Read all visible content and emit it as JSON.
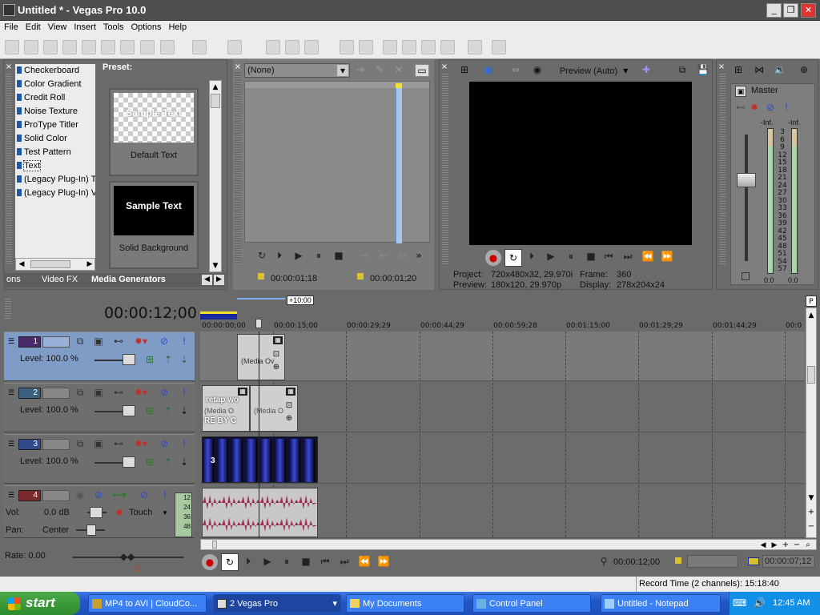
{
  "window": {
    "title": "Untitled * - Vegas Pro 10.0"
  },
  "menu": [
    "File",
    "Edit",
    "View",
    "Insert",
    "Tools",
    "Options",
    "Help"
  ],
  "generators": {
    "items": [
      "Checkerboard",
      "Color Gradient",
      "Credit Roll",
      "Noise Texture",
      "ProType Titler",
      "Solid Color",
      "Test Pattern",
      "Text",
      "(Legacy Plug-In) T",
      "(Legacy Plug-In) V"
    ],
    "selected": "Text",
    "preset_label": "Preset:",
    "presets": [
      {
        "sample": "Sample Text",
        "caption": "Default Text"
      },
      {
        "sample": "Sample Text",
        "caption": "Solid Background"
      }
    ],
    "tabs": [
      "ons",
      "Video FX",
      "Media Generators"
    ]
  },
  "trimmer": {
    "dropdown": "(None)",
    "time_in": "00:00:01;18",
    "time_out": "00:00:01;20"
  },
  "preview": {
    "mode": "Preview (Auto)",
    "project_label": "Project:",
    "project_value": "720x480x32, 29.970i",
    "frame_label": "Frame:",
    "frame_value": "360",
    "preview_label": "Preview:",
    "preview_value": "180x120, 29.970p",
    "display_label": "Display:",
    "display_value": "278x204x24"
  },
  "mixer": {
    "title": "Master",
    "inf_left": "-Inf.",
    "inf_right": "-Inf.",
    "scale": [
      "3",
      "6",
      "9",
      "12",
      "15",
      "18",
      "21",
      "24",
      "27",
      "30",
      "33",
      "36",
      "39",
      "42",
      "45",
      "48",
      "51",
      "54",
      "57"
    ],
    "bottom_left": "0.0",
    "bottom_right": "0.0"
  },
  "timeline": {
    "timecode": "00:00:12;00",
    "zoom_label": "+10:00",
    "ruler": [
      "00:00:00;00",
      "00:00:15;00",
      "00:00:29;29",
      "00:00:44;29",
      "00:00:59;28",
      "00:01:15;00",
      "00:01:29;29",
      "00:01:44;29",
      "00:0"
    ],
    "tracks": [
      {
        "num": "1",
        "level": "Level: 100.0 %",
        "color": "#4a2a6a"
      },
      {
        "num": "2",
        "level": "Level: 100.0 %",
        "color": "#3b5f7e"
      },
      {
        "num": "3",
        "level": "Level: 100.0 %",
        "color": "#2e4a8a"
      },
      {
        "num": "4",
        "color": "#7a2a2a",
        "vol_label": "Vol:",
        "vol_value": "0.0 dB",
        "pan_label": "Pan:",
        "pan_value": "Center",
        "mode": "Touch"
      }
    ],
    "meter_labels": [
      "12",
      "24",
      "36",
      "48"
    ],
    "clip_text_1": "(Media Ov",
    "clip_text_2a": "retap wo",
    "clip_text_2b": "(Media O",
    "clip_text_2c": "RE BY C",
    "clip_text_2d": "(Media O",
    "video_clip_num": "3"
  },
  "transport": {
    "rate": "Rate: 0.00",
    "cursor_time": "00:00:12;00",
    "end_time": "00:00:07;12"
  },
  "status": {
    "record_time": "Record Time (2 channels): 15:18:40"
  },
  "taskbar": {
    "start": "start",
    "tasks": [
      "MP4 to AVI | CloudCo...",
      "2 Vegas Pro",
      "My Documents",
      "Control Panel",
      "Untitled - Notepad"
    ],
    "clock": "12:45 AM"
  }
}
